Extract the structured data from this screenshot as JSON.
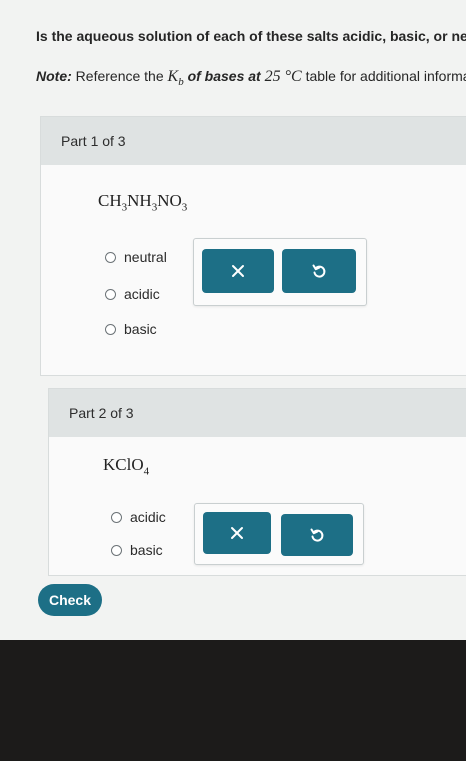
{
  "question": "Is the aqueous solution of each of these salts acidic, basic, or neutral?",
  "note": {
    "prefix": "Note:",
    "reference_text": "Reference the",
    "kb_symbol": "K",
    "kb_sub": "b",
    "of_bases_text": "of bases at",
    "temperature": "25 °C",
    "suffix": "table for additional information."
  },
  "parts": [
    {
      "header": "Part 1 of 3",
      "formula": [
        {
          "t": "CH"
        },
        {
          "s": "3"
        },
        {
          "t": "NH"
        },
        {
          "s": "3"
        },
        {
          "t": "NO"
        },
        {
          "s": "3"
        }
      ],
      "options": [
        "neutral",
        "acidic",
        "basic"
      ]
    },
    {
      "header": "Part 2 of 3",
      "formula": [
        {
          "t": "KClO"
        },
        {
          "s": "4"
        }
      ],
      "options": [
        "acidic",
        "basic"
      ]
    }
  ],
  "tools": {
    "clear_icon": "x-icon",
    "undo_icon": "undo-icon"
  },
  "check_label": "Check",
  "colors": {
    "accent": "#1d6f86",
    "header_bg": "#dfe3e3",
    "panel_bg": "#fafafa"
  }
}
